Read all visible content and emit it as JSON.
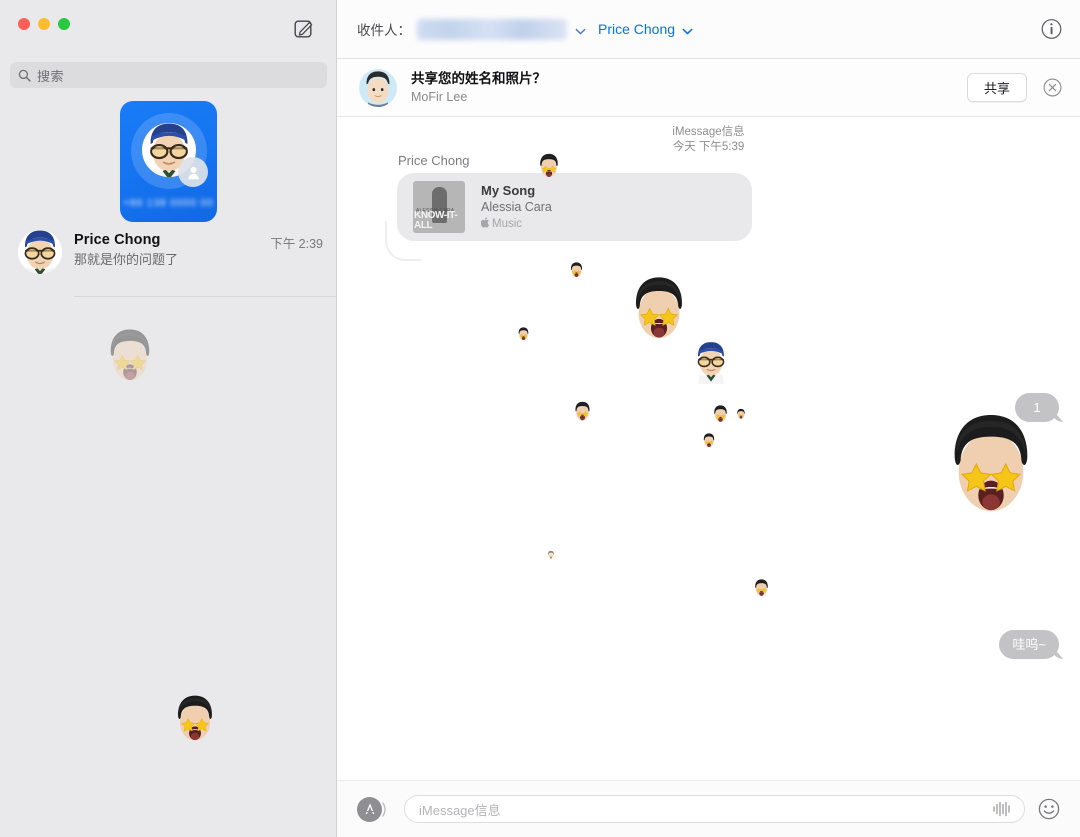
{
  "window": {
    "traffic_lights": [
      "close",
      "minimize",
      "zoom"
    ],
    "colors": {
      "close": "#ff5f57",
      "minimize": "#febc2e",
      "zoom": "#28c840",
      "accent_blue": "#0a71e8",
      "sidebar_bg": "#e9e9eb",
      "bubble_in": "#e9e9eb",
      "bubble_out": "#c3c3c6",
      "tile_blue": "#1573f0"
    }
  },
  "sidebar": {
    "compose_icon": "compose-icon",
    "search": {
      "icon": "search-icon",
      "placeholder": "搜索"
    },
    "share_tile": {
      "badge_icon": "person-icon",
      "number": "+86 138 0000 00"
    },
    "conversations": [
      {
        "name": "Price Chong",
        "snippet": "那就是你的问题了",
        "time": "下午 2:39"
      }
    ]
  },
  "toolbar": {
    "to_label": "收件人：",
    "recipient_redacted": "",
    "recipient_name": "Price Chong",
    "chevron_icon": "chevron-down-icon",
    "info_icon": "info-icon"
  },
  "banner": {
    "title": "共享您的姓名和照片？",
    "subtitle": "MoFir Lee",
    "share_label": "共享",
    "close_icon": "close-circle-icon"
  },
  "conversation": {
    "service": "iMessage信息",
    "timestamp": "今天 下午5:39",
    "sender_name": "Price Chong",
    "music_card": {
      "title": "My Song",
      "artist": "Alessia Cara",
      "source": "Music",
      "apple_glyph": "",
      "artwork_line1": "ALESSIA CARA",
      "artwork_line2": "KNOW-IT-ALL"
    },
    "outgoing": [
      {
        "text": "1"
      },
      {
        "text": "哇呜~"
      }
    ]
  },
  "composer": {
    "apps_icon": "app-store-icon",
    "placeholder": "iMessage信息",
    "audio_icon": "audio-waveform-icon",
    "emoji_icon": "emoji-smiley-icon"
  }
}
